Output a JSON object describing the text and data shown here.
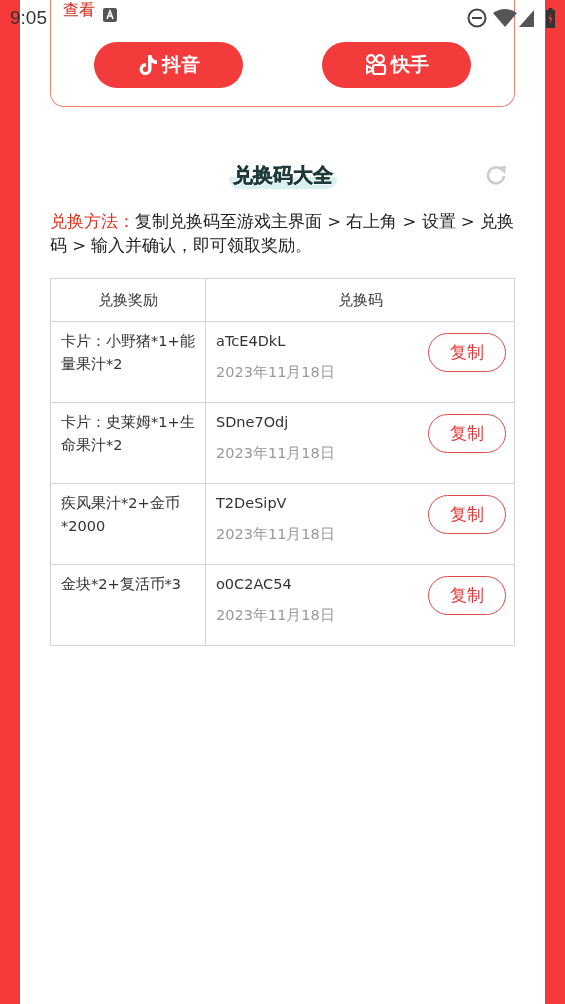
{
  "status_bar": {
    "time": "9:05"
  },
  "share_card": {
    "link": "查看",
    "buttons": [
      {
        "kind": "douyin",
        "label": "抖音"
      },
      {
        "kind": "kuaishou",
        "label": "快手"
      }
    ]
  },
  "section": {
    "title": "兑换码大全"
  },
  "instructions": {
    "label": "兑换方法：",
    "text": "复制兑换码至游戏主界面 > 右上角 > 设置 > 兑换码 > 输入并确认，即可领取奖励。"
  },
  "table": {
    "columns": [
      "兑换奖励",
      "兑换码"
    ],
    "rows": [
      {
        "reward": "卡片：小野猪*1+能量果汁*2",
        "code": "aTcE4DkL",
        "date": "2023年11月18日",
        "button": "复制"
      },
      {
        "reward": "卡片：史莱姆*1+生命果汁*2",
        "code": "SDne7Odj",
        "date": "2023年11月18日",
        "button": "复制"
      },
      {
        "reward": "疾风果汁*2+金币*2000",
        "code": "T2DeSipV",
        "date": "2023年11月18日",
        "button": "复制"
      },
      {
        "reward": "金块*2+复活币*3",
        "code": "o0C2AC54",
        "date": "2023年11月18日",
        "button": "复制"
      }
    ]
  }
}
